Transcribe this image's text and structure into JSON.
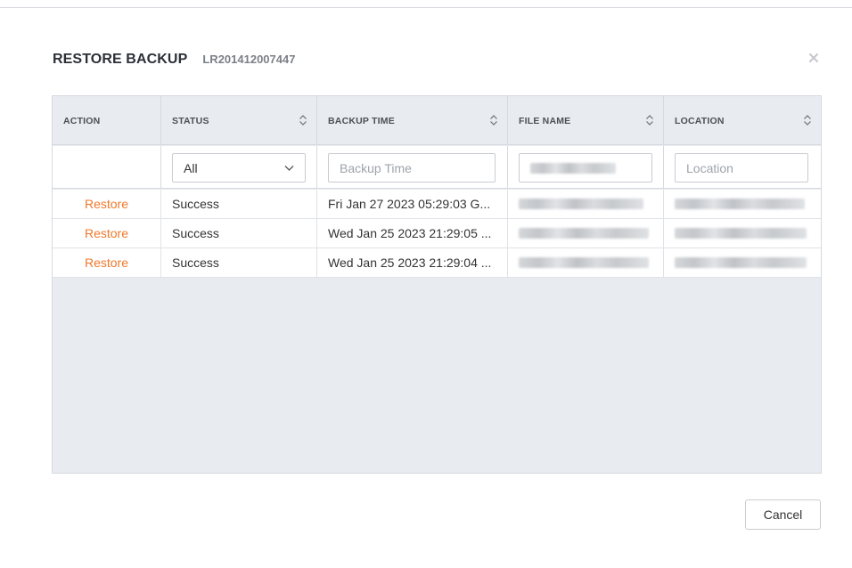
{
  "dialog": {
    "title": "RESTORE BACKUP",
    "subtitle": "LR201412007447",
    "close_icon": "close-icon",
    "cancel_label": "Cancel"
  },
  "table": {
    "columns": [
      {
        "key": "action",
        "label": "ACTION",
        "sortable": false
      },
      {
        "key": "status",
        "label": "STATUS",
        "sortable": true
      },
      {
        "key": "backup_time",
        "label": "BACKUP TIME",
        "sortable": true
      },
      {
        "key": "file_name",
        "label": "FILE NAME",
        "sortable": true
      },
      {
        "key": "location",
        "label": "LOCATION",
        "sortable": true
      }
    ],
    "filters": {
      "status_selected": "All",
      "backup_time_placeholder": "Backup Time",
      "file_name_value": "",
      "location_placeholder": "Location"
    },
    "rows": [
      {
        "action": "Restore",
        "status": "Success",
        "backup_time": "Fri Jan 27 2023 05:29:03 G..."
      },
      {
        "action": "Restore",
        "status": "Success",
        "backup_time": "Wed Jan 25 2023 21:29:05 ..."
      },
      {
        "action": "Restore",
        "status": "Success",
        "backup_time": "Wed Jan 25 2023 21:29:04 ..."
      }
    ]
  },
  "colors": {
    "accent_link": "#f0782a",
    "grid_background": "#e8ebef",
    "border": "#d6d9de"
  }
}
